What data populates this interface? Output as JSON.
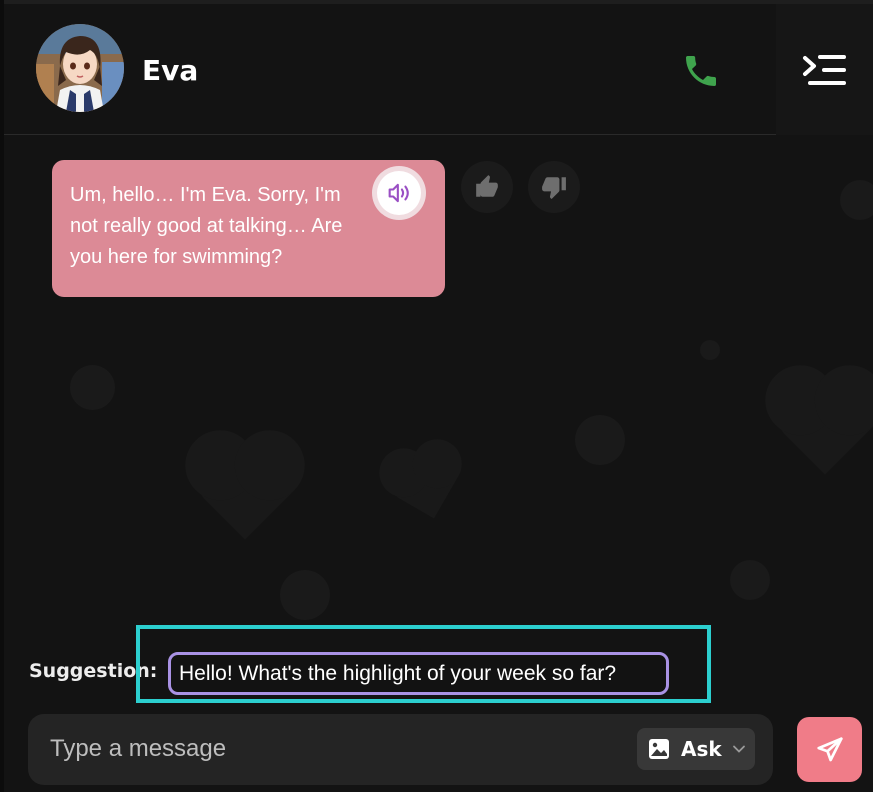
{
  "header": {
    "name": "Eva",
    "avatar_icon": "character-avatar",
    "call_icon": "phone-icon",
    "menu_icon": "sidebar-toggle-icon"
  },
  "message": {
    "text": "Um, hello… I'm Eva. Sorry, I'm not really good at talking… Are you here for swimming?",
    "bubble_color": "#dc8a96",
    "speaker_icon": "speaker-icon",
    "like_icon": "thumbs-up-icon",
    "dislike_icon": "thumbs-down-icon"
  },
  "suggestion": {
    "label": "Suggestion:",
    "text": "Hello! What's the highlight of your week so far?",
    "highlight_color": "#2ccfcf",
    "chip_border_color": "#a992e4"
  },
  "composer": {
    "placeholder": "Type a message",
    "mode_label": "Ask",
    "mode_icon": "image-icon",
    "dropdown_icon": "chevron-down-icon",
    "send_icon": "send-icon",
    "send_color": "#f07c88"
  },
  "colors": {
    "background": "#131313",
    "call_green": "#3fa34d"
  }
}
